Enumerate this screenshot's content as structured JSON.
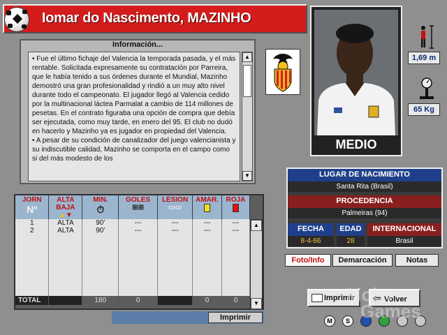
{
  "header": {
    "player_name": "Iomar do Nascimento, MAZINHO"
  },
  "info": {
    "title": "Información...",
    "paragraphs": [
      "• Fue el último fichaje del Valencia la temporada pasada, y el más rentable. Solicitada expresamente su contratación por Parreira, que le había tenido a sus órdenes durante el Mundial, Mazinho demostró una gran profesionalidad y rindió a un muy alto nivel durante todo el campeonato. El jugador llegó al Valencia cedido por la multinacional láctea Parmalat a cambio de 114 millones de pesetas. En el contrato figuraba una opción de compra que debía ser ejecutada, como muy tarde, en enero del 95. El club no dudó en hacerlo y Mazinho ya es jugador en propiedad del Valencia.",
      "• A pesar de su condición de canalizador del juego valencianista y su indiscutible calidad, Mazinho se comporta en el campo como si del más modesto de los"
    ]
  },
  "crest": {
    "club_text": "VALENCIA C.F."
  },
  "photo": {
    "position": "MEDIO"
  },
  "height": {
    "value": "1,69 m"
  },
  "weight": {
    "value": "65 Kg"
  },
  "birth": {
    "place_header": "LUGAR DE NACIMIENTO",
    "place_value": "Santa Rita (Brasil)",
    "origin_header": "PROCEDENCIA",
    "origin_value": "Palmeiras (94)",
    "date_header": "FECHA",
    "date_value": "8-4-66",
    "age_header": "EDAD",
    "age_value": "28",
    "intl_header": "INTERNACIONAL",
    "intl_value": "Brasil"
  },
  "tabs": [
    {
      "label": "Foto/Info"
    },
    {
      "label": "Demarcación"
    },
    {
      "label": "Notas"
    }
  ],
  "table": {
    "headers": [
      "JORN",
      "ALTA BAJA",
      "MIN.",
      "GOLES",
      "LESION",
      "AMAR.",
      "ROJA"
    ],
    "sub_no": "Nº",
    "rows": [
      [
        "1",
        "ALTA",
        "90'",
        "---",
        "---",
        "---",
        "---"
      ],
      [
        "2",
        "ALTA",
        "90'",
        "---",
        "---",
        "---",
        "---"
      ]
    ],
    "total": [
      "TOTAL",
      "",
      "180",
      "0",
      "",
      "0",
      "0"
    ]
  },
  "buttons": {
    "print_small": "Imprimir",
    "print_big": "Imprimir",
    "back": "Volver"
  },
  "bottom_icons": [
    "M",
    "S"
  ],
  "watermark": {
    "line1": "Moby",
    "line2": "Games"
  },
  "colors": {
    "title_red": "#d41c1c",
    "header_blue": "#9bb5cf",
    "panel_dark": "#3a3a3a"
  }
}
